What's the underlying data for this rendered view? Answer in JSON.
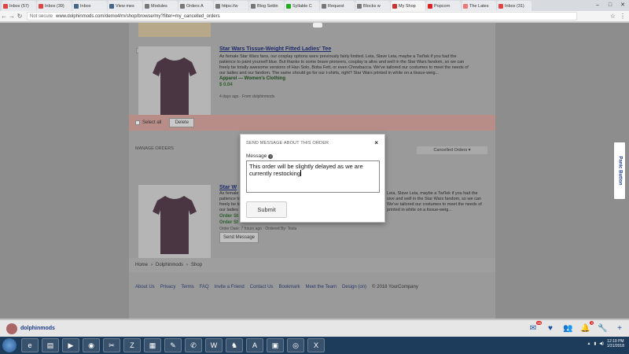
{
  "browser": {
    "tabs": [
      {
        "label": "Inbox (57)",
        "color": "#d44"
      },
      {
        "label": "Inbox (39)",
        "color": "#d44"
      },
      {
        "label": "Inbox",
        "color": "#468"
      },
      {
        "label": "View mes",
        "color": "#468"
      },
      {
        "label": "Modules",
        "color": "#777"
      },
      {
        "label": "Orders A",
        "color": "#777"
      },
      {
        "label": "https://w",
        "color": "#777"
      },
      {
        "label": "Blog Settin",
        "color": "#777"
      },
      {
        "label": "Syllable C",
        "color": "#2a2"
      },
      {
        "label": "Request",
        "color": "#777"
      },
      {
        "label": "Blocks w",
        "color": "#777"
      },
      {
        "label": "My Shop",
        "color": "#c33",
        "active": true
      },
      {
        "label": "Popcorn",
        "color": "#d22"
      },
      {
        "label": "The Lates",
        "color": "#e77"
      },
      {
        "label": "Inbox (31)",
        "color": "#d44"
      }
    ],
    "not_secure": "Not secure",
    "url": "www.dolphinmods.com/demo4/m/shop/browse/my?filter=my_cancelled_orders"
  },
  "page": {
    "product1": {
      "title": "Star Wars Tissue-Weight Fitted Ladies' Tee",
      "desc": "As female Star Wars fans, our cosplay options were previously fairly limited. Leia, Slave Leia, maybe a Twi'lek if you had the patience to paint yourself blue. But thanks to some brave pioneers, cosplay is alive and well in the Star Wars fandom, so we can freely be totally awesome versions of Han Solo, Boba Fett, or even Chewbacca. We've tailored our costumes to meet the needs of our ladies and our fandom. The same should go for our t-shirts, right? Star Wars printed in white on a tissue-weig...",
      "category": "Apparel — Women's Clothing",
      "price": "$ 0.04",
      "meta": "4 days ago · From dolphinmods"
    },
    "select_all": "Select all",
    "delete": "Delete",
    "manage_orders": "MANAGE ORDERS",
    "cancelled_orders": "Cancelled Orders ▾",
    "product2": {
      "title": "Star W",
      "desc_left": "As female\npatience to paint yourself\nfreely be totally\nour ladies",
      "desc_right": "Leia, Slave Leia, maybe a Twi'lek if you had the\nsive and well in the Star Wars fandom, so we can\nWe've tailored our costumes to meet the needs of\nprinted in white on a tissue-weig...",
      "order_status1": "Order St",
      "order_status2": "Order St",
      "meta": "Order Date: 7 hours ago · Ordered By: Tesla",
      "send_message": "Send Message"
    },
    "breadcrumb": [
      "Home",
      "›",
      "Dolphinmods",
      "›",
      "Shop"
    ],
    "footer": [
      "About Us",
      "Privacy",
      "Terms",
      "FAQ",
      "Invite a Friend",
      "Contact Us",
      "Bookmark",
      "Meet the Team",
      "Design (on)"
    ],
    "copyright": "© 2018 YourCompany",
    "panic": "Panic Button"
  },
  "modal": {
    "header": "SEND MESSAGE ABOUT THIS ORDER",
    "close": "×",
    "label": "Message",
    "info_icon": "i",
    "message": "This order will be slightly delayed as we are currently restocking",
    "submit": "Submit"
  },
  "sitebar": {
    "username": "dolphinmods",
    "badges": {
      "mail": "15",
      "notifications": "2"
    }
  },
  "taskbar": {
    "time": "12:19 PM",
    "date": "1/31/2018"
  },
  "colors": {
    "accent_link": "#1c2a6a",
    "action_bar": "#b88c87",
    "taskbar": "#1d3b5a"
  }
}
